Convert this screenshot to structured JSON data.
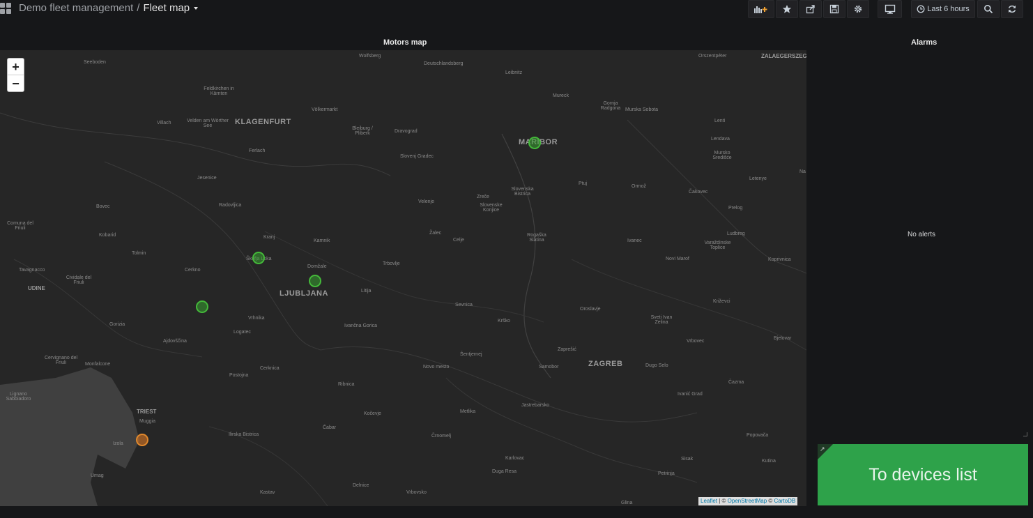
{
  "header": {
    "dashboard_folder": "Demo fleet management",
    "separator": "/",
    "dashboard_title": "Fleet map",
    "time_range": "Last 6 hours",
    "icons": [
      "add-panel-icon",
      "star-icon",
      "share-icon",
      "save-icon",
      "gear-icon",
      "monitor-icon",
      "clock-icon",
      "search-icon",
      "refresh-icon"
    ]
  },
  "map_panel": {
    "title": "Motors map",
    "zoom_in": "+",
    "zoom_out": "−",
    "attribution": {
      "leaflet": "Leaflet",
      "pipe": " | © ",
      "osm": "OpenStreetMap",
      "copy": " © ",
      "carto": "CartoDB"
    },
    "cities": [
      "Wolfsberg",
      "Deutschlandsberg",
      "Leibnitz",
      "Orszentpéter",
      "ZALAEGERSZEG",
      "Seeboden",
      "Feldkirchen in Kärnten",
      "Völkermarkt",
      "Mureck",
      "Gornja Radgona",
      "Murska Sobota",
      "Villach",
      "Velden am Wörther See",
      "KLAGENFURT",
      "Bleiburg / Pliberk",
      "Dravograd",
      "MARIBOR",
      "Lenti",
      "Lendava",
      "Mursko Središće",
      "Ferlach",
      "Slovenj Gradec",
      "Jesenice",
      "Slovenska Bistrica",
      "Ptuj",
      "Ormož",
      "Letenye",
      "Bovec",
      "Radovljica",
      "Velenje",
      "Zreče",
      "Slovenske Konjice",
      "Čakovec",
      "Prelog",
      "Comuna del Friuli",
      "Kobarid",
      "Kranj",
      "Kamnik",
      "Žalec",
      "Celje",
      "Rogaška Slatina",
      "Ivanec",
      "Varaždinske Toplice",
      "Ludbreg",
      "Tolmin",
      "Škofja Loka",
      "Domžale",
      "Trbovlje",
      "Novi Marof",
      "Koprivnica",
      "Tavagnacco",
      "Cividale del Friuli",
      "Cerkno",
      "UDINE",
      "LJUBLJANA",
      "Litija",
      "Sevnica",
      "Oroslavje",
      "Križevci",
      "Gorizia",
      "Vrhnika",
      "Krško",
      "Sveti Ivan Zelina",
      "Ivančna Gorica",
      "Logatec",
      "Ajdovščina",
      "Bjelovar",
      "Vrbovec",
      "Cervignano del Friuli",
      "Monfalcone",
      "Šentjernej",
      "Zaprešić",
      "ZAGREB",
      "Samobor",
      "Dugo Selo",
      "Novo mesto",
      "Cerknica",
      "Postojna",
      "Čazma",
      "Lignano Sabbiadoro",
      "Ribnica",
      "Jastrebarsko",
      "Ivanić Grad",
      "TRIEST",
      "Kočevje",
      "Metlika",
      "Muggia",
      "Izola",
      "Ilirska Bistrica",
      "Čabar",
      "Črnomelj",
      "Popovača",
      "Umag",
      "Karlovac",
      "Sisak",
      "Kutina",
      "Duga Resa",
      "Petrinja",
      "Delnice",
      "Kastav",
      "Vrbovsko",
      "Glina",
      "Na"
    ],
    "markers": [
      {
        "name": "MARIBOR",
        "status": "ok",
        "color": "#44b93a"
      },
      {
        "name": "Škofja Loka",
        "status": "ok",
        "color": "#44b93a"
      },
      {
        "name": "Domžale",
        "status": "ok",
        "color": "#44b93a"
      },
      {
        "name": "Cerkno area",
        "status": "ok",
        "color": "#44b93a"
      },
      {
        "name": "Muggia",
        "status": "warning",
        "color": "#e0882c"
      }
    ]
  },
  "alarms_panel": {
    "title": "Alarms",
    "empty_text": "No alerts"
  },
  "devices_button": {
    "label": "To devices list",
    "color": "#2ea24a"
  }
}
